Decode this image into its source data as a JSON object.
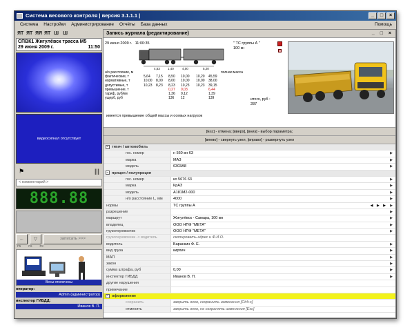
{
  "window": {
    "title": "Система весового контроля  |  версия 3.1.1.1 |"
  },
  "menu": {
    "items": [
      "Система",
      "Настройки",
      "Администрирование",
      "Отчёты",
      "База данных"
    ],
    "help": "Помощь"
  },
  "toolbar": {
    "icons": [
      "ЯТ",
      "ЯТ",
      "ЯЯ",
      "ЯТ",
      "Ш",
      "Ш"
    ]
  },
  "left": {
    "station_name": "СПВК1 Жигулёвск трасса М5",
    "date": "29 июня 2009 г.",
    "time": "11:50",
    "video_message": "видеосигнал отсутствует",
    "comment_placeholder": "< комментарий >",
    "display_value": "888.88",
    "send_button": "записать >>>",
    "prev_button": "←",
    "filter_button": "▽",
    "f_keys": [
      "F5",
      "F6",
      "F8"
    ],
    "scale_status": "Весы отключены",
    "operator_label": "оператор:",
    "operator_value": "Admin (администратор)",
    "inspector_label": "инспектор ГИБДД:",
    "inspector_value": "Иванов В. П."
  },
  "right": {
    "title": "Запись журнала (редактирование)",
    "window_buttons": "_ □ ×",
    "report": {
      "date": "29 июня 2009 г.",
      "time": "11:00:35",
      "ts_group": "\" ТС группы А \"",
      "ts_load": "100 кн",
      "axle_distances": [
        "4,53",
        "1,40",
        "4,00",
        "5,20"
      ],
      "rows": [
        [
          "н/о расстояние, м",
          "",
          "",
          "",
          "",
          "",
          "",
          "полная масса"
        ],
        [
          "фактические, т",
          "5,64",
          "7,15",
          "8,50",
          "10,00",
          "10,20",
          "45,59",
          ""
        ],
        [
          "нормативные, т",
          "10,00",
          "8,00",
          "8,00",
          "10,00",
          "10,00",
          "38,00",
          ""
        ],
        [
          "допустимые, т",
          "10,23",
          "8,23",
          "8,23",
          "10,23",
          "10,23",
          "39,15",
          ""
        ],
        [
          "превышение, т",
          "",
          "",
          "0,27",
          "0,03",
          "",
          "6,44",
          ""
        ],
        [
          "тариф, руб/км",
          "",
          "",
          "1,36",
          "0,12",
          "",
          "1,39",
          ""
        ],
        [
          "ущерб, руб",
          "",
          "",
          "136",
          "12",
          "",
          "139",
          ""
        ]
      ],
      "total_label": "итого, руб :",
      "total_value": "287",
      "warning": "имеется превышение общей массы и осевых нагрузок"
    },
    "hints": [
      "[Esc] - отмена; [вверх], [вниз] - выбор параметра;",
      "[влево] - свернуть узел, [вправо] - развернуть узел"
    ],
    "grid": [
      {
        "type": "cat",
        "label": "тягач / автомобиль"
      },
      {
        "type": "field",
        "label": "гос. номер",
        "value": "н 560 вн 63"
      },
      {
        "type": "field",
        "label": "марка",
        "value": "МАЗ"
      },
      {
        "type": "field",
        "label": "модель",
        "value": "6303А8"
      },
      {
        "type": "cat",
        "label": "прицеп / полуприцеп"
      },
      {
        "type": "field",
        "label": "гос. номер",
        "value": "ко 5676 63"
      },
      {
        "type": "field",
        "label": "марка",
        "value": "КрАЗ"
      },
      {
        "type": "field",
        "label": "модель",
        "value": "А181М2-000"
      },
      {
        "type": "field",
        "label": "н/о расстояние L, мм",
        "value": "4000"
      },
      {
        "type": "top",
        "label": "нормы",
        "value": "ТС группы А",
        "extra": "◀ ▶ ▶"
      },
      {
        "type": "top",
        "label": "разрешение",
        "value": ""
      },
      {
        "type": "top",
        "label": "маршрут",
        "value": "Жигулёвск - Самара, 100 км"
      },
      {
        "type": "top",
        "label": "владелец",
        "value": "ООО НПФ \"МЕТА\""
      },
      {
        "type": "top",
        "label": "грузоперевозчик",
        "value": "ООО НПФ \"МЕТА\""
      },
      {
        "type": "disabled",
        "label": "грузоперевозчик -> водитель",
        "value": "скопировать адрес и Ф.И.О."
      },
      {
        "type": "top",
        "label": "водитель",
        "value": "Баранкин Ф. Е."
      },
      {
        "type": "top",
        "label": "вид груза",
        "value": "кирпич"
      },
      {
        "type": "top",
        "label": "МАП",
        "value": ""
      },
      {
        "type": "top",
        "label": "закон",
        "value": ""
      },
      {
        "type": "top",
        "label": "сумма штрафа, руб",
        "value": "0,00"
      },
      {
        "type": "top",
        "label": "инспектор ГИБДД",
        "value": "Иванов В. П."
      },
      {
        "type": "top",
        "label": "другие нарушения",
        "value": ""
      },
      {
        "type": "top",
        "label": "примечание",
        "value": ""
      },
      {
        "type": "yellow",
        "label": "оформление"
      },
      {
        "type": "disabled",
        "label": "сохранить",
        "value": "закрыть окно, сохранить изменения [Ctrl+s]"
      },
      {
        "type": "muted",
        "label": "отменить",
        "value": "закрыть окно, не сохранять изменения [Esc]"
      }
    ]
  }
}
